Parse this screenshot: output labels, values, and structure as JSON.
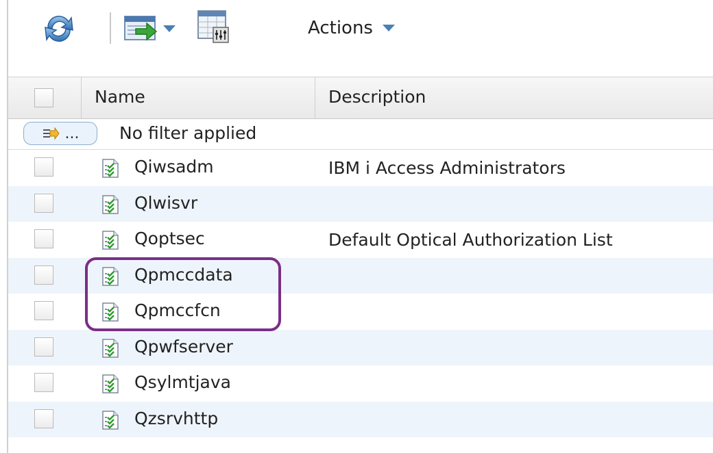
{
  "toolbar": {
    "refresh_icon": "refresh-icon",
    "export_icon": "export-icon",
    "columns_icon": "columns-icon",
    "actions_label": "Actions"
  },
  "table": {
    "columns": [
      "Name",
      "Description"
    ],
    "filter": {
      "button_label": "...",
      "status": "No filter applied"
    },
    "rows": [
      {
        "name": "Qiwsadm",
        "description": "IBM i Access Administrators"
      },
      {
        "name": "Qlwisvr",
        "description": ""
      },
      {
        "name": "Qoptsec",
        "description": "Default Optical Authorization List"
      },
      {
        "name": "Qpmccdata",
        "description": ""
      },
      {
        "name": "Qpmccfcn",
        "description": ""
      },
      {
        "name": "Qpwfserver",
        "description": ""
      },
      {
        "name": "Qsylmtjava",
        "description": ""
      },
      {
        "name": "Qzsrvhttp",
        "description": ""
      }
    ]
  },
  "colors": {
    "highlight": "#7a2e86",
    "alt_row": "#eef4fb"
  }
}
